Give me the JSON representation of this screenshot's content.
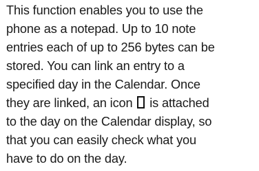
{
  "paragraph": {
    "lines": [
      "This function enables you to use the",
      "phone as a notepad. Up to 10 note",
      "entries each of up to 256 bytes can be",
      "stored. You can link an entry to a",
      "specified day in the Calendar. Once",
      "they are linked, an icon",
      "is attached",
      "to the day on the Calendar display, so",
      "that you can easily check what you",
      "have to do on the day."
    ],
    "inline_icon": "note-icon"
  }
}
